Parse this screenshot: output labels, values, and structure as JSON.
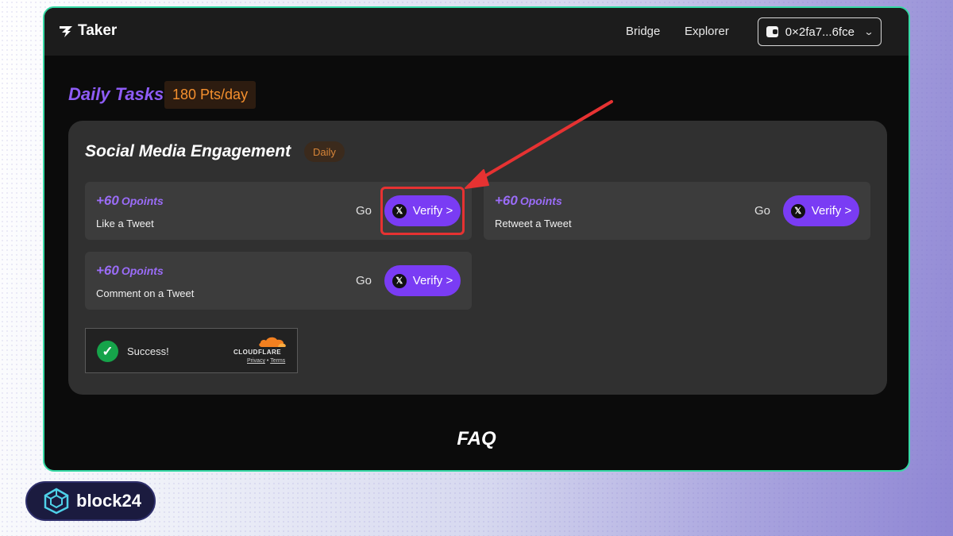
{
  "header": {
    "brand": "Taker",
    "nav": [
      "Bridge",
      "Explorer"
    ],
    "wallet_address": "0×2fa7...6fce"
  },
  "daily": {
    "title": "Daily Tasks",
    "points_per_day": "180 Pts/day"
  },
  "panel": {
    "title": "Social Media Engagement",
    "badge": "Daily",
    "tasks": [
      {
        "points": "+60",
        "unit": "Opoints",
        "label": "Like a Tweet",
        "go": "Go",
        "verify": "Verify >"
      },
      {
        "points": "+60",
        "unit": "Opoints",
        "label": "Retweet a Tweet",
        "go": "Go",
        "verify": "Verify >"
      },
      {
        "points": "+60",
        "unit": "Opoints",
        "label": "Comment on a Tweet",
        "go": "Go",
        "verify": "Verify >"
      }
    ]
  },
  "captcha": {
    "status": "Success!",
    "provider": "CLOUDFLARE",
    "privacy": "Privacy",
    "separator": "•",
    "terms": "Terms"
  },
  "faq": "FAQ",
  "watermark": "block24",
  "colors": {
    "accent": "#7a3cf4",
    "points": "#9a6cf7",
    "badge_orange": "#f5902e",
    "frame": "#36d9a5",
    "annotation": "#e63232"
  }
}
